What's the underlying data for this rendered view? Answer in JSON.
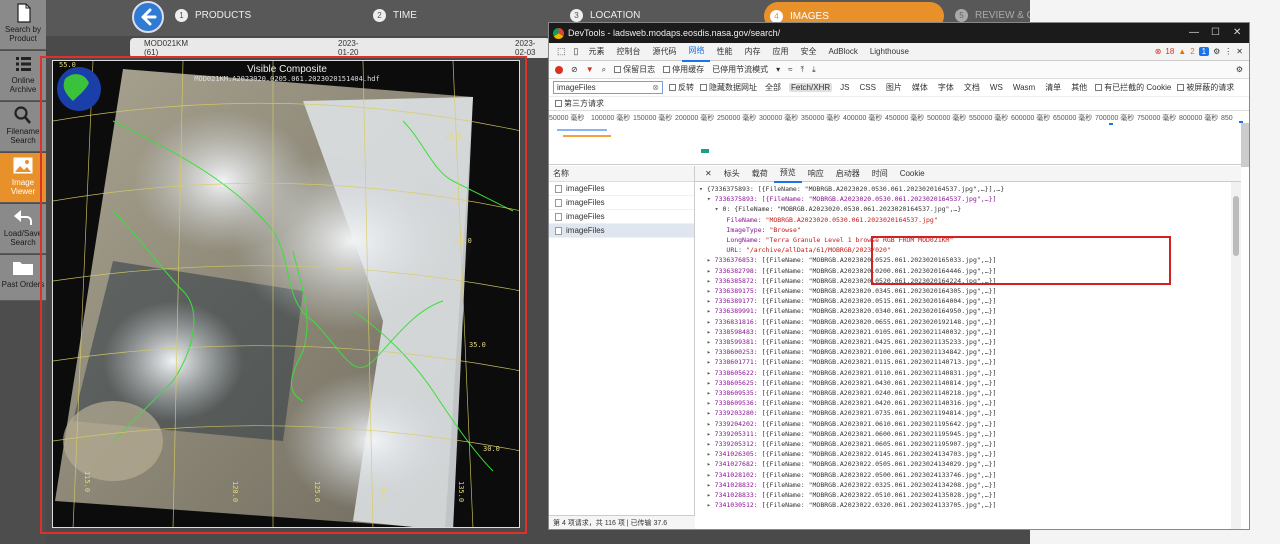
{
  "sidebar": {
    "items": [
      {
        "label1": "Search by",
        "label2": "Product",
        "icon": "document-icon"
      },
      {
        "label1": "Online",
        "label2": "Archive",
        "icon": "list-icon"
      },
      {
        "label1": "Filename",
        "label2": "Search",
        "icon": "search-icon"
      },
      {
        "label1": "Image",
        "label2": "Viewer",
        "icon": "image-icon"
      },
      {
        "label1": "Load/Save",
        "label2": "Search",
        "icon": "load-icon"
      },
      {
        "label1": "Past Orders",
        "label2": "",
        "icon": "folder-icon"
      }
    ]
  },
  "wizard": {
    "steps": [
      {
        "num": "1",
        "label": "PRODUCTS"
      },
      {
        "num": "2",
        "label": "TIME"
      },
      {
        "num": "3",
        "label": "LOCATION"
      },
      {
        "num": "4",
        "label": "IMAGES"
      },
      {
        "num": "5",
        "label": "REVIEW & ORDER"
      }
    ]
  },
  "info": {
    "product": "MOD021KM (61)",
    "date_start": "2023-01-20",
    "date_end": "2023-02-03"
  },
  "viewer": {
    "title": "Visible Composite",
    "filename": "MOD021KM.A2023020.0205.061.2023020151404.hdf",
    "lat_labels": [
      "55.0",
      "45.0",
      "40.0",
      "35.0",
      "30.0"
    ],
    "lon_labels": [
      "115.0",
      "120.0",
      "125.0",
      "130.0",
      "135.0"
    ]
  },
  "devtools": {
    "window_title": "DevTools - ladsweb.modaps.eosdis.nasa.gov/search/",
    "tabs": [
      "元素",
      "控制台",
      "源代码",
      "网络",
      "性能",
      "内存",
      "应用",
      "安全",
      "AdBlock",
      "Lighthouse"
    ],
    "selected_tab": "网络",
    "errors": "18",
    "warnings": "2",
    "info_count": "1",
    "toolbar": {
      "preserve_log": "保留日志",
      "disable_cache": "停用缓存",
      "throttle": "已停用节流模式"
    },
    "filter": {
      "value": "imageFiles",
      "invert": "反转",
      "hide_data_urls": "隐藏数据网址",
      "types": [
        "全部",
        "Fetch/XHR",
        "JS",
        "CSS",
        "图片",
        "媒体",
        "字体",
        "文档",
        "WS",
        "Wasm",
        "清单",
        "其他"
      ],
      "blocked_cookies": "有已拦截的 Cookie",
      "blocked_requests": "被屏蔽的请求",
      "third_party": "第三方请求"
    },
    "timeline_ticks": [
      "50000 毫秒",
      "100000 毫秒",
      "150000 毫秒",
      "200000 毫秒",
      "250000 毫秒",
      "300000 毫秒",
      "350000 毫秒",
      "400000 毫秒",
      "450000 毫秒",
      "500000 毫秒",
      "550000 毫秒",
      "600000 毫秒",
      "650000 毫秒",
      "700000 毫秒",
      "750000 毫秒",
      "800000 毫秒",
      "850"
    ],
    "names_header": "名称",
    "requests": [
      "imageFiles",
      "imageFiles",
      "imageFiles",
      "imageFiles"
    ],
    "status_bar": "第 4 项请求，共 116 项",
    "status_bar_transferred": "已传输 37.6",
    "detail_tabs": [
      "标头",
      "载荷",
      "预览",
      "响应",
      "启动器",
      "时间",
      "Cookie"
    ],
    "detail_selected": "预览",
    "json_root": "{7336375893: [{FileName: \"MOBRGB.A2023020.0530.061.2023020164537.jpg\",…}],…}",
    "json_expanded_key": "7336375893: [{FileName: \"MOBRGB.A2023020.0530.061.2023020164537.jpg\",…}]",
    "json_expanded_item": "0: {FileName: \"MOBRGB.A2023020.0530.061.2023020164537.jpg\",…}",
    "json_fields": [
      {
        "key": "FileName",
        "value": "\"MOBRGB.A2023020.0530.061.2023020164537.jpg\""
      },
      {
        "key": "ImageType",
        "value": "\"Browse\""
      },
      {
        "key": "LongName",
        "value": "\"Terra Granule Level 1 browse RGB FROM MOD021KM\""
      },
      {
        "key": "URL",
        "value": "\"/archive/allData/61/MOBRGB/2023/020\""
      }
    ],
    "json_rows": [
      {
        "id": "7336376853",
        "file": "MOBRGB.A2023020.0525.061.2023020165033.jpg"
      },
      {
        "id": "7336382798",
        "file": "MOBRGB.A2023020.0200.061.2023020164446.jpg"
      },
      {
        "id": "7336385872",
        "file": "MOBRGB.A2023020.0520.061.2023020164224.jpg"
      },
      {
        "id": "7336389175",
        "file": "MOBRGB.A2023020.0345.061.2023020164305.jpg"
      },
      {
        "id": "7336389177",
        "file": "MOBRGB.A2023020.0515.061.2023020164004.jpg"
      },
      {
        "id": "7336389991",
        "file": "MOBRGB.A2023020.0340.061.2023020164950.jpg"
      },
      {
        "id": "7336831816",
        "file": "MOBRGB.A2023020.0655.061.2023020192148.jpg"
      },
      {
        "id": "7338598483",
        "file": "MOBRGB.A2023021.0105.061.2023021140032.jpg"
      },
      {
        "id": "7338599381",
        "file": "MOBRGB.A2023021.0425.061.2023021135233.jpg"
      },
      {
        "id": "7338600253",
        "file": "MOBRGB.A2023021.0100.061.2023021134842.jpg"
      },
      {
        "id": "7338601771",
        "file": "MOBRGB.A2023021.0115.061.2023021140713.jpg"
      },
      {
        "id": "7338605622",
        "file": "MOBRGB.A2023021.0110.061.2023021140831.jpg"
      },
      {
        "id": "7338605625",
        "file": "MOBRGB.A2023021.0430.061.2023021140814.jpg"
      },
      {
        "id": "7338609535",
        "file": "MOBRGB.A2023021.0240.061.2023021140218.jpg"
      },
      {
        "id": "7338609536",
        "file": "MOBRGB.A2023021.0420.061.2023021140316.jpg"
      },
      {
        "id": "7339203280",
        "file": "MOBRGB.A2023021.0735.061.2023021194814.jpg"
      },
      {
        "id": "7339204202",
        "file": "MOBRGB.A2023021.0610.061.2023021195642.jpg"
      },
      {
        "id": "7339205311",
        "file": "MOBRGB.A2023021.0600.061.2023021195945.jpg"
      },
      {
        "id": "7339205312",
        "file": "MOBRGB.A2023021.0605.061.2023021195907.jpg"
      },
      {
        "id": "7341026305",
        "file": "MOBRGB.A2023022.0145.061.2023024134703.jpg"
      },
      {
        "id": "7341027682",
        "file": "MOBRGB.A2023022.0505.061.2023024134029.jpg"
      },
      {
        "id": "7341028102",
        "file": "MOBRGB.A2023022.0500.061.2023024133746.jpg"
      },
      {
        "id": "7341028832",
        "file": "MOBRGB.A2023022.0325.061.2023024134208.jpg"
      },
      {
        "id": "7341028833",
        "file": "MOBRGB.A2023022.0510.061.2023024135028.jpg"
      },
      {
        "id": "7341030512",
        "file": "MOBRGB.A2023022.0320.061.2023024133705.jpg"
      }
    ]
  }
}
